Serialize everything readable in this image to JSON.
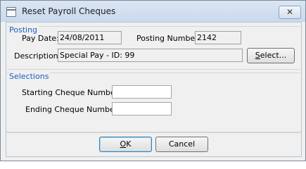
{
  "window": {
    "title": "Reset Payroll Cheques",
    "close_glyph": "✕"
  },
  "posting": {
    "group_title": "Posting",
    "pay_date_label": "Pay Date:",
    "pay_date_value": "24/08/2011",
    "posting_number_label": "Posting Number:",
    "posting_number_value": "2142",
    "description_label": "Description:",
    "description_value": "Special Pay - ID: 99",
    "select_button": {
      "accel": "S",
      "rest": "elect..."
    }
  },
  "selections": {
    "group_title": "Selections",
    "starting_label": "Starting Cheque Number:",
    "starting_value": "",
    "ending_label": "Ending Cheque Number:",
    "ending_value": ""
  },
  "buttons": {
    "ok": {
      "accel": "O",
      "rest": "K"
    },
    "cancel_label": "Cancel"
  }
}
